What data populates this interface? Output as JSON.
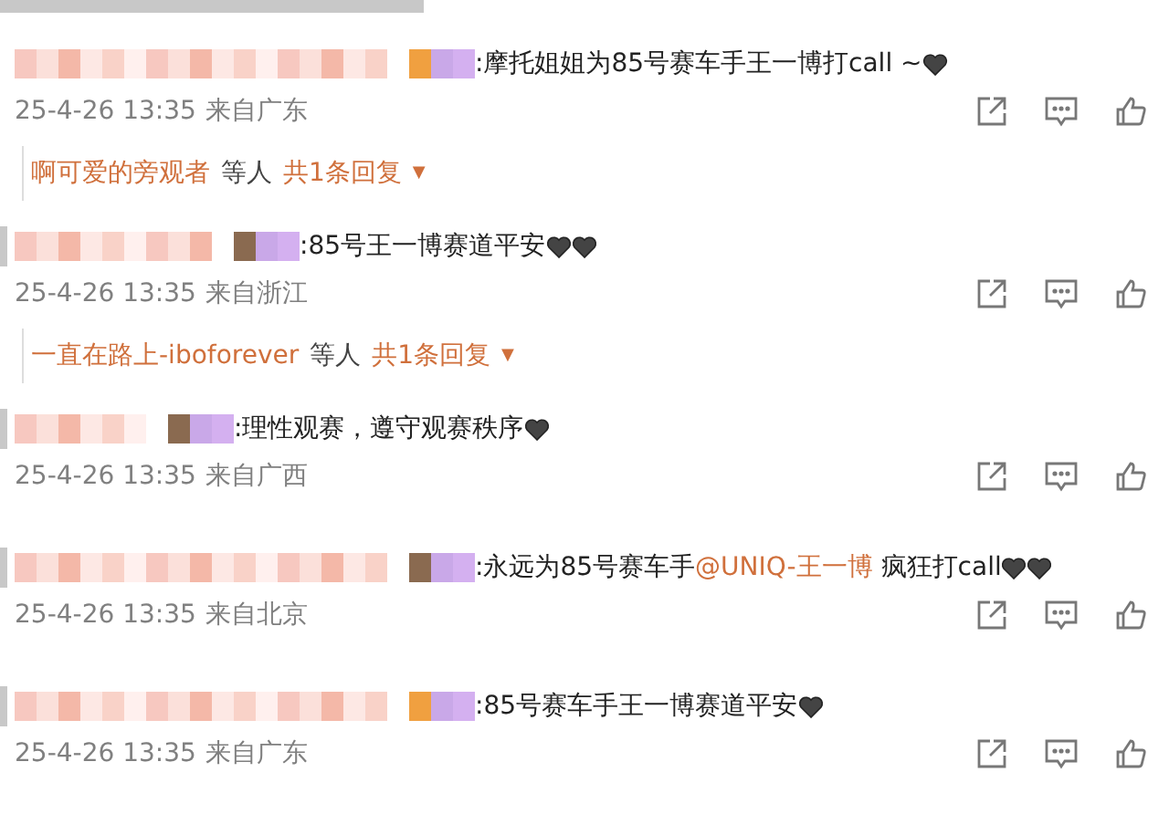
{
  "comments": [
    {
      "username": {
        "kind": "blurred"
      },
      "text": [
        {
          "kind": "text",
          "value": ":摩托姐姐为85号赛车手王一博打call ~"
        },
        {
          "kind": "heart"
        }
      ],
      "time": "25-4-26 13:35",
      "location": "来自广东",
      "reply": {
        "replier": "啊可爱的旁观者",
        "suffix": "等人",
        "count": "共1条回复",
        "caret": "▼"
      }
    },
    {
      "username": {
        "kind": "blurred"
      },
      "text": [
        {
          "kind": "text",
          "value": ":85号王一博赛道平安"
        },
        {
          "kind": "heart"
        },
        {
          "kind": "heart"
        }
      ],
      "time": "25-4-26 13:35",
      "location": "来自浙江",
      "reply": {
        "replier": "一直在路上-iboforever",
        "suffix": "等人",
        "count": "共1条回复",
        "caret": "▼"
      }
    },
    {
      "username": {
        "kind": "blurred"
      },
      "text": [
        {
          "kind": "text",
          "value": ":理性观赛，遵守观赛秩序"
        },
        {
          "kind": "heart"
        }
      ],
      "time": "25-4-26 13:35",
      "location": "来自广西"
    },
    {
      "username": {
        "kind": "blurred"
      },
      "text": [
        {
          "kind": "text",
          "value": ":永远为85号赛车手"
        },
        {
          "kind": "mention",
          "value": "@UNIQ-王一博"
        },
        {
          "kind": "text",
          "value": " 疯狂打call"
        },
        {
          "kind": "heart"
        },
        {
          "kind": "heart"
        }
      ],
      "time": "25-4-26 13:35",
      "location": "来自北京"
    },
    {
      "username": {
        "kind": "blurred"
      },
      "text": [
        {
          "kind": "text",
          "value": ":85号赛车手王一博赛道平安"
        },
        {
          "kind": "heart"
        }
      ],
      "time": "25-4-26 13:35",
      "location": "来自广东"
    }
  ]
}
